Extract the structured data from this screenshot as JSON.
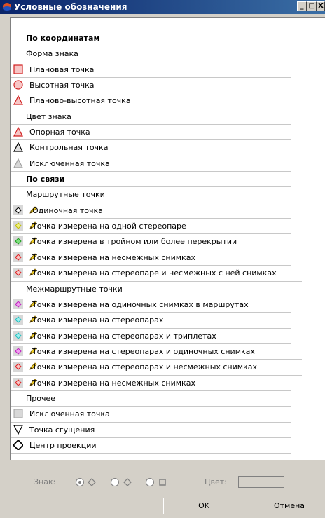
{
  "window": {
    "title": "Условные обозначения",
    "min_label": "_",
    "max_label": "□",
    "close_label": "X"
  },
  "rows": [
    {
      "text": "По координатам",
      "type": "hdr"
    },
    {
      "text": "Форма знака",
      "type": "sub"
    },
    {
      "text": "Плановая точка",
      "icon": "red-square-icon"
    },
    {
      "text": "Высотная точка",
      "icon": "red-circle-icon"
    },
    {
      "text": "Планово-высотная точка",
      "icon": "red-triangle-icon"
    },
    {
      "text": "Цвет знака",
      "type": "sub"
    },
    {
      "text": "Опорная точка",
      "icon": "red-triangle-icon"
    },
    {
      "text": "Контрольная точка",
      "icon": "black-triangle-icon"
    },
    {
      "text": "Исключенная точка",
      "icon": "gray-triangle-icon"
    },
    {
      "text": "По связи",
      "type": "hdr"
    },
    {
      "text": "Маршрутные точки",
      "type": "sub"
    },
    {
      "text": "Одиночная точка",
      "icon": "black-diamond-icon",
      "pen": true
    },
    {
      "text": "Точка измерена на одной стереопаре",
      "icon": "yellow-diamond-icon",
      "pen": true
    },
    {
      "text": "Точка измерена в тройном или более перекрытии",
      "icon": "green-diamond-icon",
      "pen": true
    },
    {
      "text": "Точка измерена на несмежных снимках",
      "icon": "red-diamond-icon",
      "pen": true
    },
    {
      "text": "Точка измерена на стереопаре и несмежных с ней снимках",
      "icon": "red-diamond-icon",
      "pen": true
    },
    {
      "text": "Межмаршрутные точки",
      "type": "sub"
    },
    {
      "text": "Точка измерена на одиночных снимках в маршрутах",
      "icon": "magenta-diamond-icon",
      "pen": true
    },
    {
      "text": "Точка измерена на стереопарах",
      "icon": "cyan-diamond-icon",
      "pen": true
    },
    {
      "text": "Точка измерена на стереопарах и триплетах",
      "icon": "cyan-diamond-icon",
      "pen": true
    },
    {
      "text": "Точка измерена на стереопарах и одиночных снимках",
      "icon": "magenta-diamond-icon",
      "pen": true
    },
    {
      "text": "Точка измерена на стереопарах и несмежных снимках",
      "icon": "red-diamond-icon",
      "pen": true
    },
    {
      "text": "Точка измерена на несмежных снимках",
      "icon": "red-diamond-icon",
      "pen": true
    },
    {
      "text": "Прочее",
      "type": "sub"
    },
    {
      "text": "Исключенная точка",
      "icon": "gray-square-icon"
    },
    {
      "text": "Точка сгущения",
      "icon": "down-triangle-icon"
    },
    {
      "text": "Центр проекции",
      "icon": "black-big-diamond-icon"
    }
  ],
  "controls": {
    "sign_label": "Знак:",
    "color_label": "Цвет:",
    "ok_label": "OK",
    "cancel_label": "Отмена"
  }
}
